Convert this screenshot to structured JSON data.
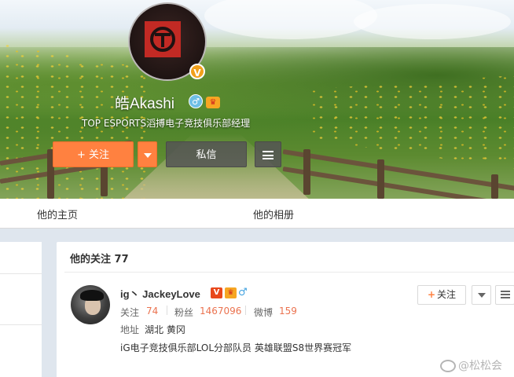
{
  "profile": {
    "name": "皓Akashi",
    "verify_mark": "V",
    "bio": "TOP ESPORTS滔搏电子竞技俱乐部经理",
    "follow_label": "+ 关注",
    "message_label": "私信",
    "avatar_icon": "top-esports-logo-icon"
  },
  "tabs": [
    {
      "label": "他的主页"
    },
    {
      "label": "他的相册"
    }
  ],
  "following": {
    "title": "他的关注 77",
    "users": [
      {
        "name": "ig丶 JackeyLove",
        "v_badge": "V",
        "gender_symbol": "♂",
        "stats": [
          {
            "label": "关注",
            "value": "74"
          },
          {
            "label": "粉丝",
            "value": "1467096"
          },
          {
            "label": "微博",
            "value": "159"
          }
        ],
        "address_label": "地址",
        "address": "湖北 黄冈",
        "description": "iG电子竞技俱乐部LOL分部队员 英雄联盟S8世界赛冠军",
        "follow_label": "关注"
      }
    ]
  },
  "watermark": "@松松会",
  "colors": {
    "accent_orange": "#ff8140",
    "stat_value": "#eb7350",
    "verify_gold": "#f2a01b"
  }
}
